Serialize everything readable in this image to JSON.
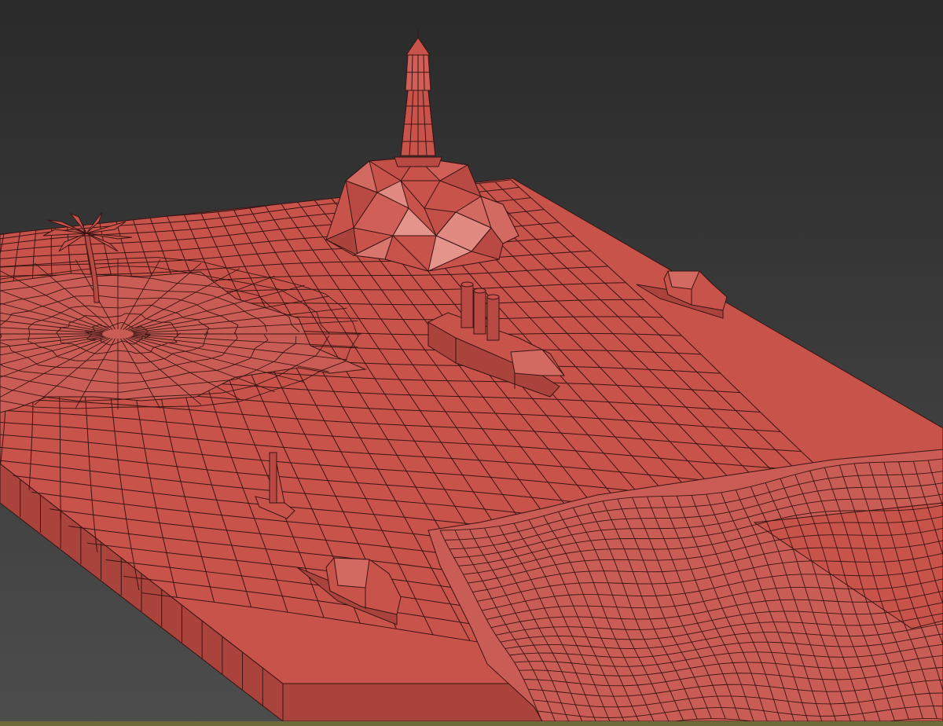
{
  "viewport": {
    "background_top": "#2a2a2a",
    "background_bottom": "#4a4a4a",
    "mesh_fill": "#c8534b",
    "mesh_fill_light": "#d26a62",
    "mesh_fill_dark": "#a9433c",
    "wire_color": "#3a1512",
    "bottom_strip_color": "#6f6a3a"
  },
  "scene_objects": [
    {
      "kind": "ocean-plane"
    },
    {
      "kind": "lighthouse"
    },
    {
      "kind": "rock-island"
    },
    {
      "kind": "palm-tree"
    },
    {
      "kind": "sand-island-left"
    },
    {
      "kind": "steamship"
    },
    {
      "kind": "boat"
    },
    {
      "kind": "boat"
    },
    {
      "kind": "sailboat"
    },
    {
      "kind": "sand-island-right"
    }
  ]
}
